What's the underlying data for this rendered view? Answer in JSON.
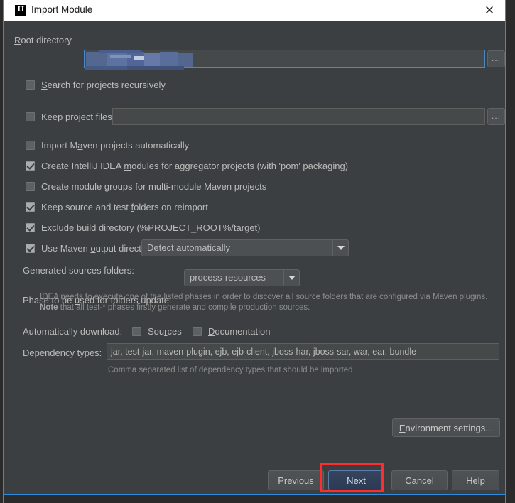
{
  "window": {
    "title": "Import Module",
    "app_icon": "intellij-idea-icon",
    "close_icon": "close-icon",
    "border_color": "#2d8ce0"
  },
  "fields": {
    "root_directory": {
      "label_prefix": "R",
      "label_mnemonic": "R",
      "label": "Root directory",
      "value": "",
      "redacted": true,
      "browse_label": "..."
    },
    "keep_project_files": {
      "label": "Keep project files in:",
      "value": "",
      "browse_label": "..."
    }
  },
  "checkboxes": [
    {
      "id": "search-recursively",
      "label": "Search for projects recursively",
      "mnemonic_index": 0,
      "checked": false
    },
    {
      "id": "keep-project-files-in",
      "label": "Keep project files in:",
      "mnemonic_index": 0,
      "checked": false
    },
    {
      "id": "import-maven-automatically",
      "label": "Import Maven projects automatically",
      "mnemonic_index": 8,
      "checked": false
    },
    {
      "id": "create-intellij-modules",
      "label": "Create IntelliJ IDEA modules for aggregator projects (with 'pom' packaging)",
      "mnemonic_index": 21,
      "checked": true
    },
    {
      "id": "create-module-groups",
      "label": "Create module groups for multi-module Maven projects",
      "mnemonic_index": 14,
      "checked": false
    },
    {
      "id": "keep-source-test-folders",
      "label": "Keep source and test folders on reimport",
      "mnemonic_index": 23,
      "checked": true
    },
    {
      "id": "exclude-build-directory",
      "label": "Exclude build directory (%PROJECT_ROOT%/target)",
      "mnemonic_index": 0,
      "checked": true
    },
    {
      "id": "use-maven-output-dirs",
      "label": "Use Maven output directories",
      "mnemonic_index": 16,
      "checked": true
    }
  ],
  "generated_sources": {
    "label": "Generated sources folders:",
    "value": "Detect automatically"
  },
  "phase_update": {
    "label": "Phase to be used for folders update:",
    "label_mnemonic": "u",
    "value": "process-resources"
  },
  "note": {
    "line1": "IDEA needs to execute one of the listed phases in order to discover all source folders that are configured via Maven plugins.",
    "line2_bold": "Note",
    "line2_rest": " that all test-* phases firstly generate and compile production sources."
  },
  "auto_download": {
    "label": "Automatically download:",
    "sources": {
      "label": "Sources",
      "checked": false
    },
    "documentation": {
      "label": "Documentation",
      "checked": false
    }
  },
  "dependency_types": {
    "label": "Dependency types:",
    "value": "jar, test-jar, maven-plugin, ejb, ejb-client, jboss-har, jboss-sar, war, ear, bundle",
    "hint": "Comma separated list of dependency types that should be imported"
  },
  "buttons": {
    "environment_settings": "Environment settings...",
    "previous": "Previous",
    "next": "Next",
    "cancel": "Cancel",
    "help": "Help"
  },
  "annotation": {
    "target": "next-button",
    "color": "#ff2d2d"
  }
}
